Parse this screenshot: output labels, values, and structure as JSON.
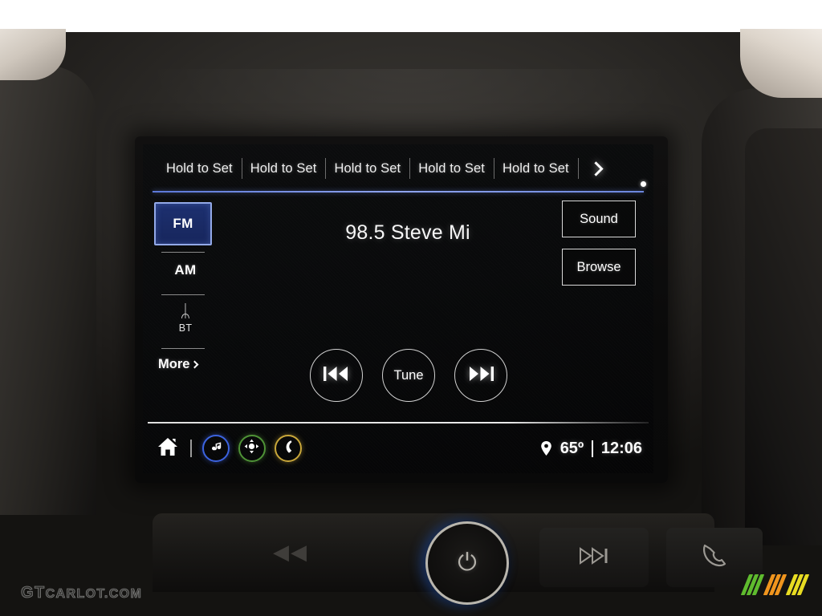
{
  "screen": {
    "presets": [
      {
        "label": "Hold to Set"
      },
      {
        "label": "Hold to Set"
      },
      {
        "label": "Hold to Set"
      },
      {
        "label": "Hold to Set"
      },
      {
        "label": "Hold to Set"
      }
    ],
    "preset_next_icon": "chevron-right-icon",
    "sources": {
      "fm": "FM",
      "am": "AM",
      "bt_icon": "ᛦ",
      "bt": "BT",
      "more": "More"
    },
    "now_playing": {
      "station": "98.5 Steve Mi"
    },
    "right_buttons": [
      {
        "label": "Sound"
      },
      {
        "label": "Browse"
      }
    ],
    "transport": {
      "previous_icon": "skip-back-icon",
      "tune_label": "Tune",
      "next_icon": "skip-forward-icon"
    },
    "bottom_bar": {
      "home_icon": "home-icon",
      "music_icon": "music-note-icon",
      "nav_icon": "navigation-compass-icon",
      "phone_icon": "phone-icon",
      "location_icon": "map-pin-icon",
      "temperature": "65º",
      "clock": "12:06"
    },
    "colors": {
      "accent_blue": "#5c78d8",
      "fm_fill": "#1d3070",
      "fm_border": "#93a9e8",
      "music_ring": "#3c63e0",
      "nav_ring": "#4f9337",
      "phone_ring": "#c9a73a",
      "screen_bg": "#0a0b0c"
    }
  },
  "hardware": {
    "power_icon": "power-icon",
    "power_glyph": "⏻",
    "next_track_icon": "skip-forward-icon",
    "phone_icon": "phone-handset-icon",
    "prev_track_icon": "skip-back-icon"
  },
  "watermark": {
    "brand_gt": "GT",
    "brand_rest": "CARLOT.COM"
  }
}
